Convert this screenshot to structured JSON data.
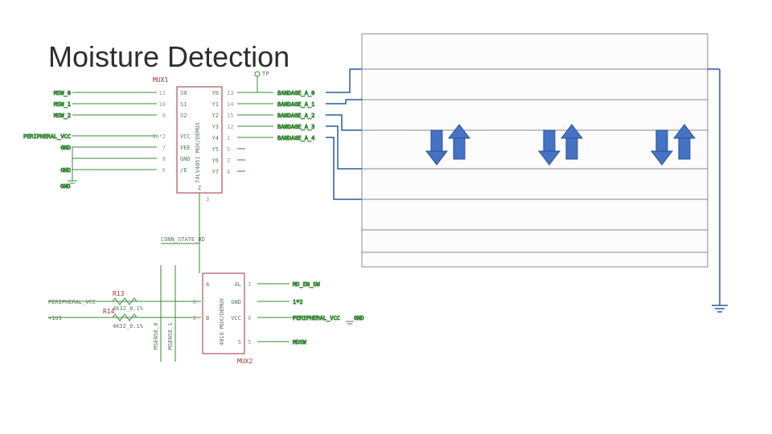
{
  "title": "Moisture Detection",
  "mux1": {
    "ref": "MUX1",
    "part": "74LV4051 MUX/DEMUX",
    "left_pins": [
      {
        "num": "11",
        "name": "S0",
        "net": "MSW_0"
      },
      {
        "num": "10",
        "name": "S1",
        "net": "MSW_1"
      },
      {
        "num": "9",
        "name": "S2",
        "net": "MSW_2"
      },
      {
        "num": "16*2",
        "name": "VCC",
        "net": "PERIPHERAL_VCC"
      },
      {
        "num": "7",
        "name": "VEE",
        "net": "GND"
      },
      {
        "num": "8",
        "name": "GND",
        "net": ""
      },
      {
        "num": "6",
        "name": "/E",
        "net": "GND"
      }
    ],
    "right_pins": [
      {
        "num": "13",
        "name": "Y0",
        "net": "BANDAGE_A_0"
      },
      {
        "num": "14",
        "name": "Y1",
        "net": "BANDAGE_A_1"
      },
      {
        "num": "15",
        "name": "Y2",
        "net": "BANDAGE_A_2"
      },
      {
        "num": "12",
        "name": "Y3",
        "net": "BANDAGE_A_3"
      },
      {
        "num": "1",
        "name": "Y4",
        "net": "BANDAGE_A_4"
      },
      {
        "num": "5",
        "name": "Y5",
        "net": ""
      },
      {
        "num": "2",
        "name": "Y6",
        "net": ""
      },
      {
        "num": "4",
        "name": "Y7",
        "net": ""
      }
    ],
    "z_pin": {
      "num": "3",
      "name": "Z"
    }
  },
  "mux2": {
    "ref": "MUX2",
    "part": "4016 MUX/DEMUX",
    "left_pins": [
      {
        "num": "",
        "name": "A"
      },
      {
        "num": "6",
        "name": ""
      },
      {
        "num": "2",
        "name": "B"
      },
      {
        "num": "",
        "name": ""
      }
    ],
    "right_pins": [
      {
        "num": "3",
        "name": "AL",
        "net": "MD_EN_SW"
      },
      {
        "num": "",
        "name": "GND",
        "net": "1*2"
      },
      {
        "num": "8",
        "name": "VCC",
        "net": "PERIPHERAL_VCC"
      },
      {
        "num": "5",
        "name": "S",
        "net": "MDSW"
      }
    ]
  },
  "resistors": {
    "r13": {
      "ref": "R13",
      "value": "4K32_0.1%"
    },
    "r14": {
      "ref": "R14",
      "value": "4K32_0.1%"
    }
  },
  "nets": {
    "periph_vcc": "PERIPHERAL_VCC",
    "v1u3": "+1U3",
    "gnd": "GND",
    "conn": "CONN_STATE_BD",
    "msense0": "MSENSE_0",
    "msense1": "MSENSE_1",
    "tp": "TP"
  },
  "grid": {
    "rows": 9,
    "cols": 3
  }
}
